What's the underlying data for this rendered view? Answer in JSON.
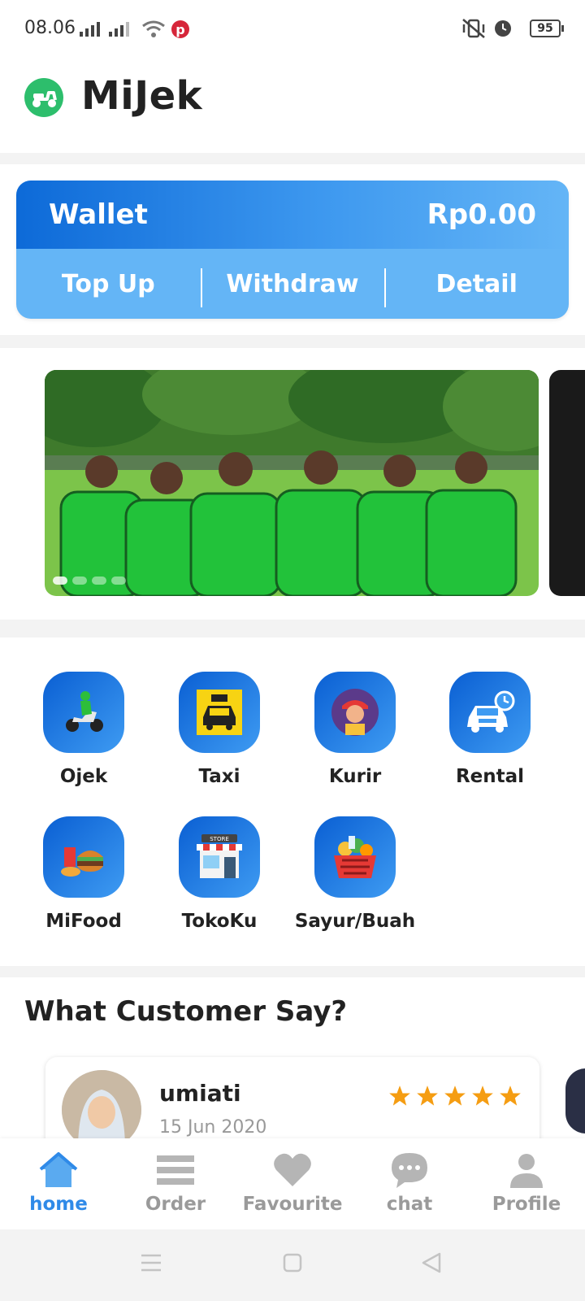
{
  "status_bar": {
    "time": "08.06",
    "battery": "95"
  },
  "header": {
    "title": "MiJek"
  },
  "wallet": {
    "label": "Wallet",
    "amount": "Rp0.00",
    "actions": [
      "Top Up",
      "Withdraw",
      "Detail"
    ]
  },
  "services": [
    {
      "label": "Ojek"
    },
    {
      "label": "Taxi"
    },
    {
      "label": "Kurir"
    },
    {
      "label": "Rental"
    },
    {
      "label": "MiFood"
    },
    {
      "label": "TokoKu"
    },
    {
      "label": "Sayur/Buah"
    }
  ],
  "testimonials": {
    "title": "What Customer Say?",
    "reviews": [
      {
        "name": "umiati",
        "date": "15 Jun 2020",
        "rating": 5
      }
    ]
  },
  "bottom_nav": [
    {
      "label": "home",
      "active": true
    },
    {
      "label": "Order"
    },
    {
      "label": "Favourite"
    },
    {
      "label": "chat"
    },
    {
      "label": "Profile"
    }
  ],
  "colors": {
    "accent": "#2f8ae8",
    "wallet_dark": "#0d6ad8",
    "wallet_light": "#64b5f6",
    "logo_green": "#2dbe6c",
    "star": "#f59d12"
  }
}
